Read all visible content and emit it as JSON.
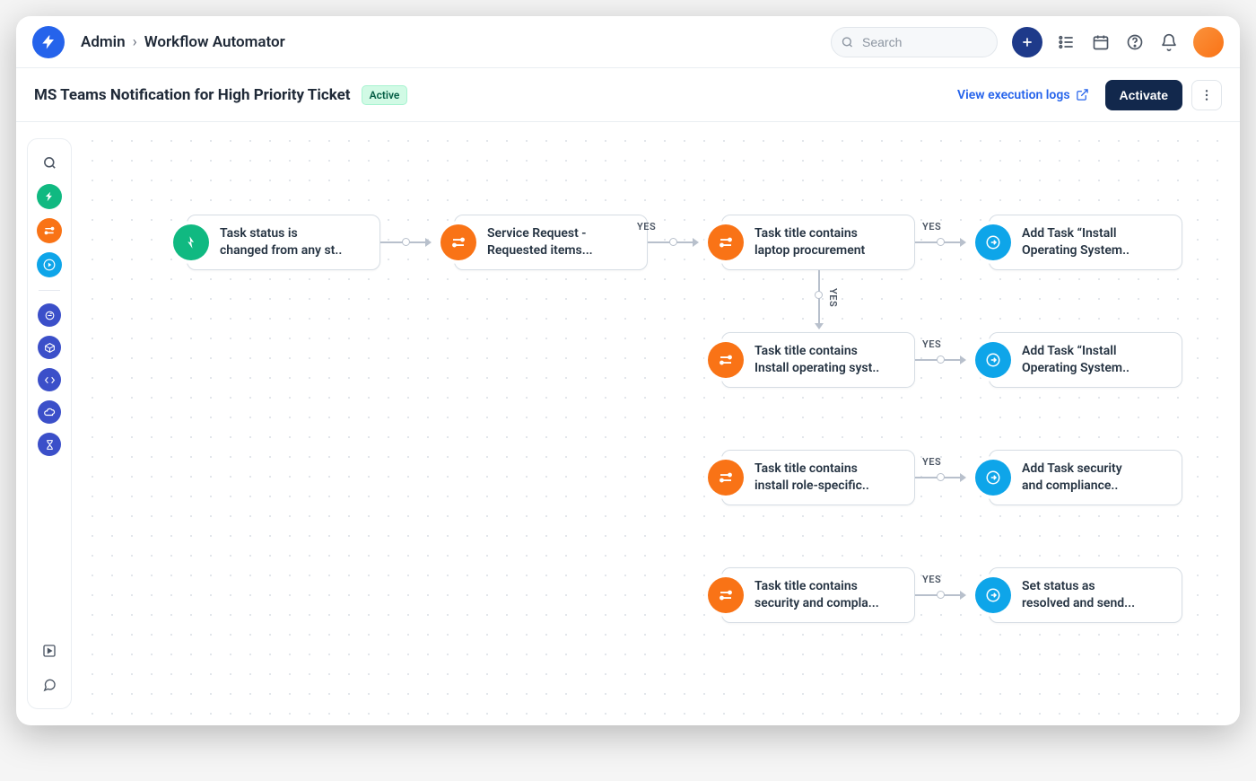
{
  "header": {
    "breadcrumb_parent": "Admin",
    "breadcrumb_current": "Workflow Automator",
    "search_placeholder": "Search"
  },
  "subheader": {
    "title": "MS Teams Notification for High Priority Ticket",
    "status_badge": "Active",
    "logs_link": "View execution logs",
    "activate_label": "Activate"
  },
  "sidetools": [
    {
      "name": "search",
      "color": "search"
    },
    {
      "name": "trigger",
      "color": "green"
    },
    {
      "name": "condition",
      "color": "orange"
    },
    {
      "name": "action",
      "color": "cyan"
    },
    {
      "name": "form",
      "color": "indigo"
    },
    {
      "name": "cube",
      "color": "indigo"
    },
    {
      "name": "code",
      "color": "indigo"
    },
    {
      "name": "cloud",
      "color": "indigo"
    },
    {
      "name": "timer",
      "color": "indigo"
    }
  ],
  "labels": {
    "yes": "YES"
  },
  "nodes": {
    "trigger1": {
      "type": "trigger",
      "line1": "Task status is",
      "line2": "changed from any st.."
    },
    "cond1": {
      "type": "condition",
      "line1": "Service Request -",
      "line2": "Requested items..."
    },
    "cond2": {
      "type": "condition",
      "line1": "Task title contains",
      "line2": "laptop procurement"
    },
    "action1": {
      "type": "action",
      "line1": "Add Task “Install",
      "line2": "Operating System.."
    },
    "cond3": {
      "type": "condition",
      "line1": "Task title contains",
      "line2": "Install operating syst.."
    },
    "action2": {
      "type": "action",
      "line1": "Add Task “Install",
      "line2": "Operating System.."
    },
    "cond4": {
      "type": "condition",
      "line1": "Task title contains",
      "line2": "install role-specific.."
    },
    "action3": {
      "type": "action",
      "line1": "Add Task security",
      "line2": "and compliance.."
    },
    "cond5": {
      "type": "condition",
      "line1": "Task title contains",
      "line2": "security and compla..."
    },
    "action4": {
      "type": "action",
      "line1": "Set status as",
      "line2": "resolved and send..."
    }
  }
}
